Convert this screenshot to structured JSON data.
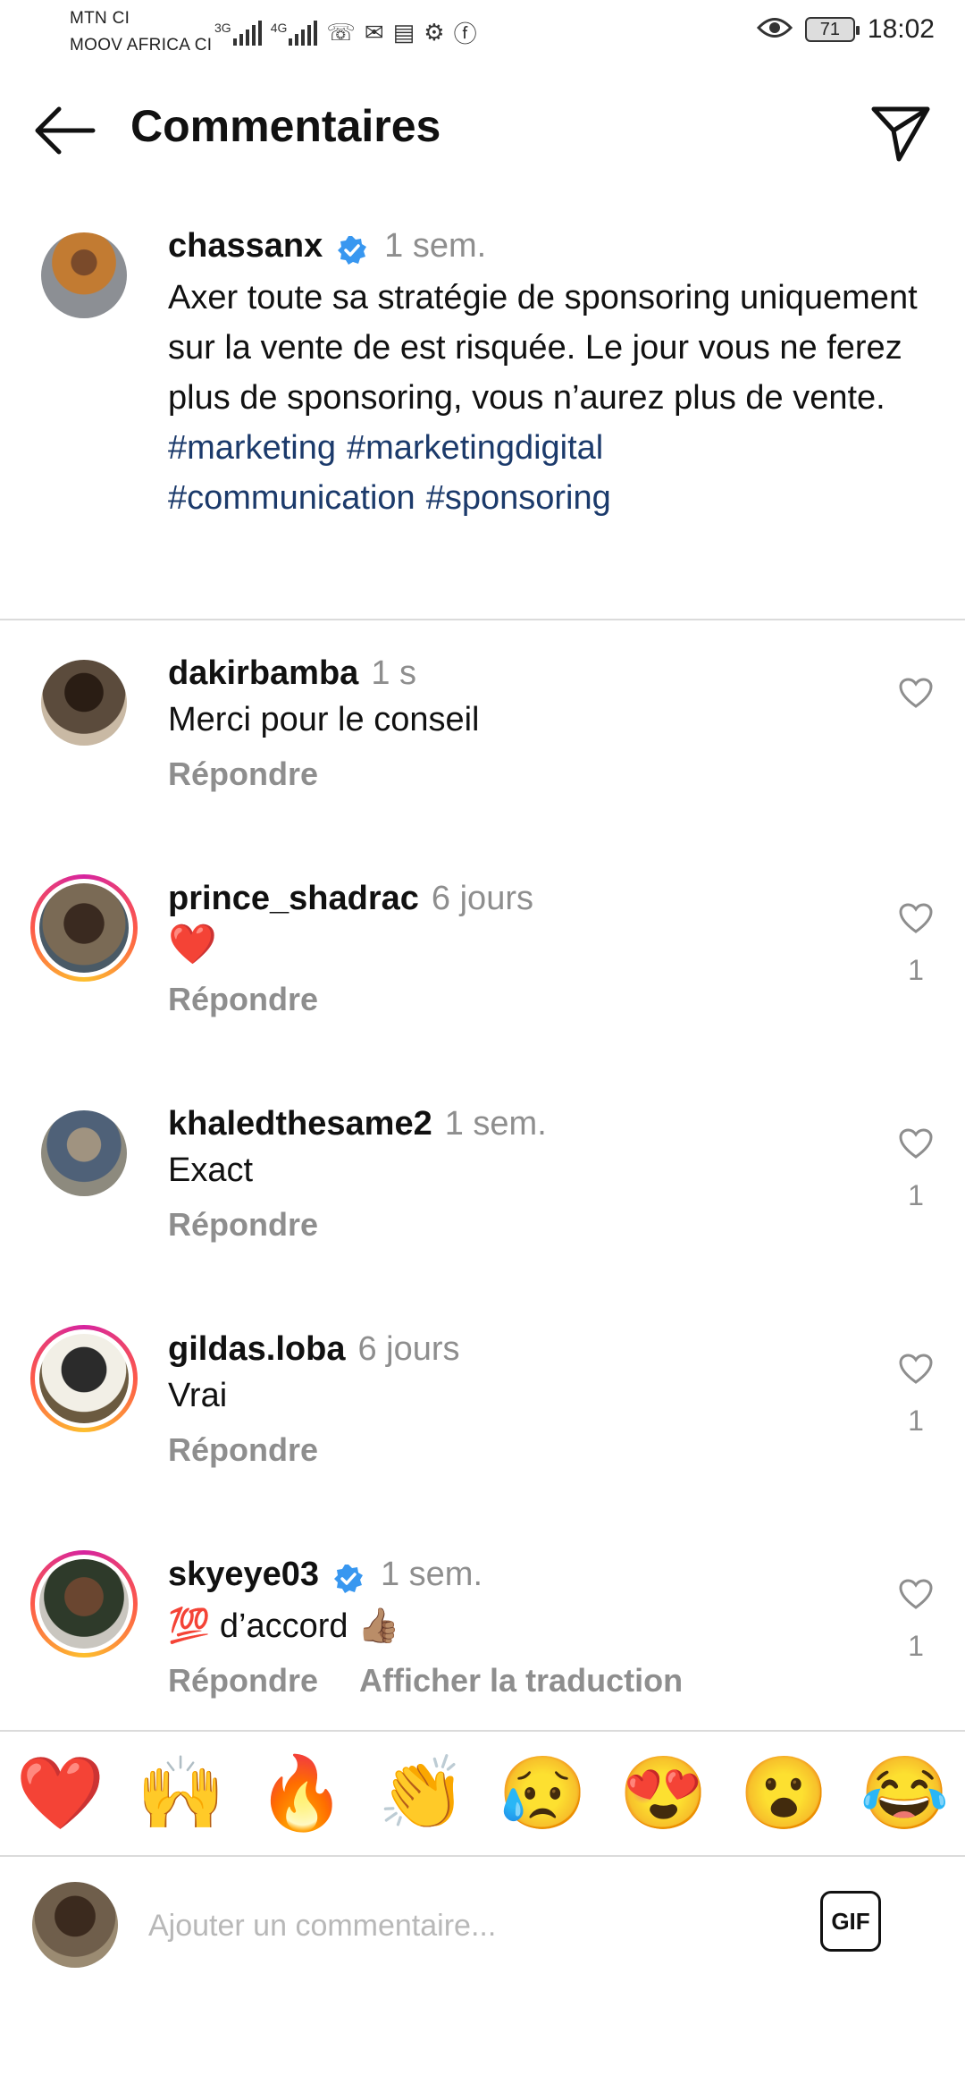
{
  "status_bar": {
    "carrier_1": "MTN CI",
    "carrier_2": "MOOV AFRICA CI",
    "net_1": "3G",
    "net_2": "4G",
    "battery": "71",
    "time": "18:02"
  },
  "header": {
    "title": "Commentaires"
  },
  "caption": {
    "username": "chassanx",
    "verified": true,
    "ago": "1 sem.",
    "text": "Axer toute sa stratégie de sponsoring uniquement sur la vente de est risquée. Le jour vous ne ferez plus de sponsoring, vous n’aurez plus de vente.",
    "hashtags": [
      "#marketing",
      "#marketingdigital",
      "#communication",
      "#sponsoring"
    ]
  },
  "comments": [
    {
      "username": "dakirbamba",
      "ago": "1 s",
      "text": "Merci pour le conseil",
      "reply": "Répondre",
      "likes": ""
    },
    {
      "username": "prince_shadrac",
      "ago": "6 jours",
      "text": "❤️",
      "reply": "Répondre",
      "likes": "1"
    },
    {
      "username": "khaledthesame2",
      "ago": "1 sem.",
      "text": "Exact",
      "reply": "Répondre",
      "likes": "1"
    },
    {
      "username": "gildas.loba",
      "ago": "6 jours",
      "text": "Vrai",
      "reply": "Répondre",
      "likes": "1"
    },
    {
      "username": "skyeye03",
      "verified": true,
      "ago": "1 sem.",
      "text": "💯 d’accord 👍🏽",
      "reply": "Répondre",
      "translate": "Afficher la traduction",
      "likes": "1"
    }
  ],
  "emoji_bar": [
    "❤️",
    "🙌",
    "🔥",
    "👏",
    "😥",
    "😍",
    "😮",
    "😂"
  ],
  "composer": {
    "placeholder": "Ajouter un commentaire...",
    "gif_label": "GIF"
  },
  "colors": {
    "hashtag": "#1b3a6b",
    "verified": "#3897f0",
    "muted": "#8e8e8e"
  }
}
